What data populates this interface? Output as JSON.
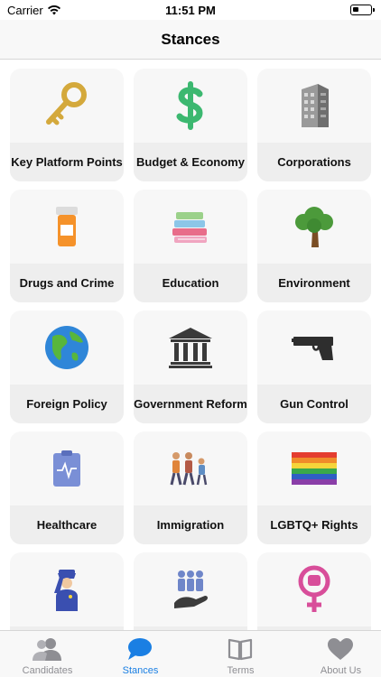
{
  "status_bar": {
    "carrier": "Carrier",
    "time": "11:51 PM"
  },
  "nav": {
    "title": "Stances"
  },
  "stances": [
    {
      "label": "Key Platform Points",
      "icon": "key-icon"
    },
    {
      "label": "Budget & Economy",
      "icon": "dollar-icon"
    },
    {
      "label": "Corporations",
      "icon": "building-icon"
    },
    {
      "label": "Drugs and Crime",
      "icon": "pill-bottle-icon"
    },
    {
      "label": "Education",
      "icon": "books-icon"
    },
    {
      "label": "Environment",
      "icon": "tree-icon"
    },
    {
      "label": "Foreign Policy",
      "icon": "globe-icon"
    },
    {
      "label": "Government Reform",
      "icon": "government-building-icon"
    },
    {
      "label": "Gun Control",
      "icon": "pistol-icon"
    },
    {
      "label": "Healthcare",
      "icon": "clipboard-heartbeat-icon"
    },
    {
      "label": "Immigration",
      "icon": "walking-family-icon"
    },
    {
      "label": "LGBTQ+ Rights",
      "icon": "rainbow-flag-icon"
    },
    {
      "label": "",
      "icon": "police-officer-icon"
    },
    {
      "label": "",
      "icon": "people-hand-icon"
    },
    {
      "label": "",
      "icon": "feminist-fist-icon"
    }
  ],
  "tabs": [
    {
      "label": "Candidates",
      "icon": "people-icon",
      "active": false
    },
    {
      "label": "Stances",
      "icon": "speech-bubble-icon",
      "active": true
    },
    {
      "label": "Terms",
      "icon": "open-book-icon",
      "active": false
    },
    {
      "label": "About Us",
      "icon": "heart-icon",
      "active": false
    }
  ],
  "colors": {
    "accent": "#1a7fe3",
    "inactive_tab": "#8e8e93",
    "card_bg": "#f7f7f7",
    "label_bg": "#eeeeee"
  }
}
